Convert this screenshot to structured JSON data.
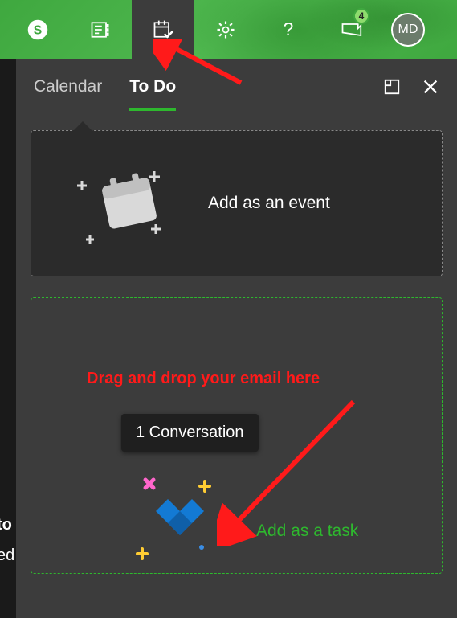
{
  "header": {
    "icons": [
      "skype",
      "onenote-feed",
      "calendar-task",
      "settings",
      "help",
      "feedback"
    ],
    "notification_count": "4",
    "avatar_initials": "MD"
  },
  "tabs": {
    "calendar": "Calendar",
    "todo": "To Do",
    "active": "todo"
  },
  "event_box": {
    "label": "Add as an event"
  },
  "task_box": {
    "chip": "1 Conversation",
    "label": "Add as a task"
  },
  "annotation": {
    "drag_hint": "Drag and drop your email here"
  },
  "left_sliver": {
    "line1": "to",
    "line2": "ed"
  }
}
